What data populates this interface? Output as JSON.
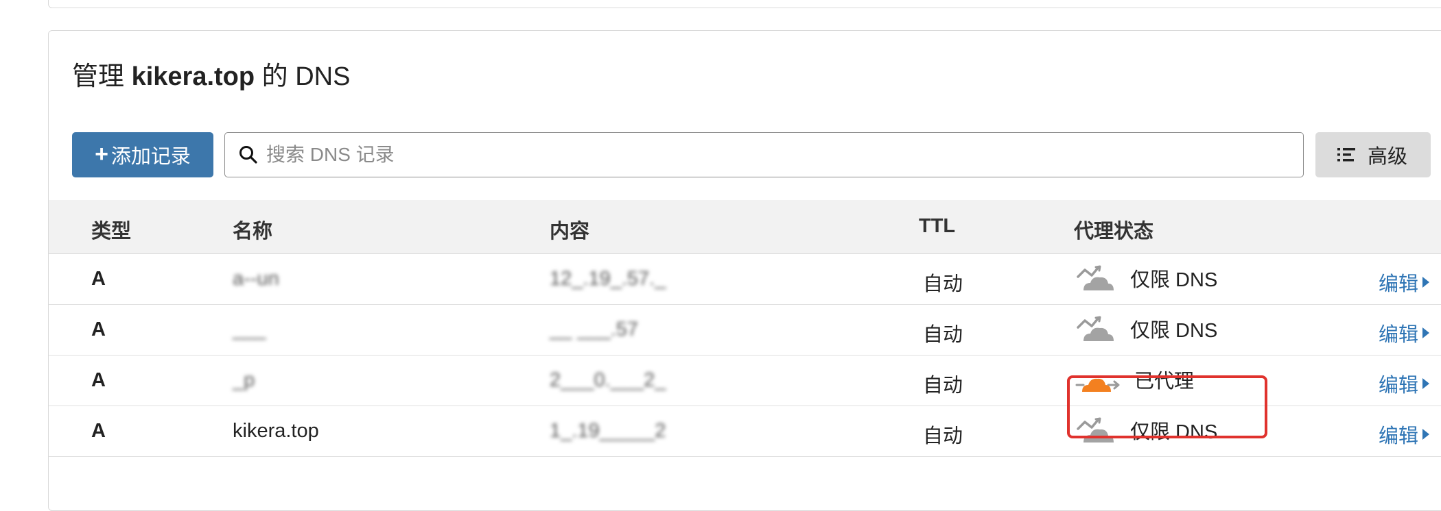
{
  "page": {
    "title_prefix": "管理",
    "domain": "kikera.top",
    "title_suffix": "的 DNS"
  },
  "toolbar": {
    "add_label": "添加记录",
    "search_placeholder": "搜索 DNS 记录",
    "advanced_label": "高级"
  },
  "table": {
    "headers": {
      "type": "类型",
      "name": "名称",
      "content": "内容",
      "ttl": "TTL",
      "proxy": "代理状态"
    },
    "rows": [
      {
        "type": "A",
        "name": "a--un",
        "content": "12_.19_.57._",
        "ttl": "自动",
        "proxy": "仅限 DNS",
        "proxied": false,
        "edit": "编辑"
      },
      {
        "type": "A",
        "name": "___",
        "content": "__ ___.57",
        "ttl": "自动",
        "proxy": "仅限 DNS",
        "proxied": false,
        "edit": "编辑"
      },
      {
        "type": "A",
        "name": "_p",
        "content": "2___0.___2_",
        "ttl": "自动",
        "proxy": "已代理",
        "proxied": true,
        "edit": "编辑"
      },
      {
        "type": "A",
        "name": "kikera.top",
        "content": "1_.19_____2",
        "ttl": "自动",
        "proxy": "仅限 DNS",
        "proxied": false,
        "edit": "编辑"
      }
    ]
  },
  "colors": {
    "primary_button": "#3d77ab",
    "link": "#2f75b5",
    "cloud_proxied": "#f38020",
    "cloud_dns_only": "#9a9a9a",
    "highlight": "#e0322d"
  }
}
